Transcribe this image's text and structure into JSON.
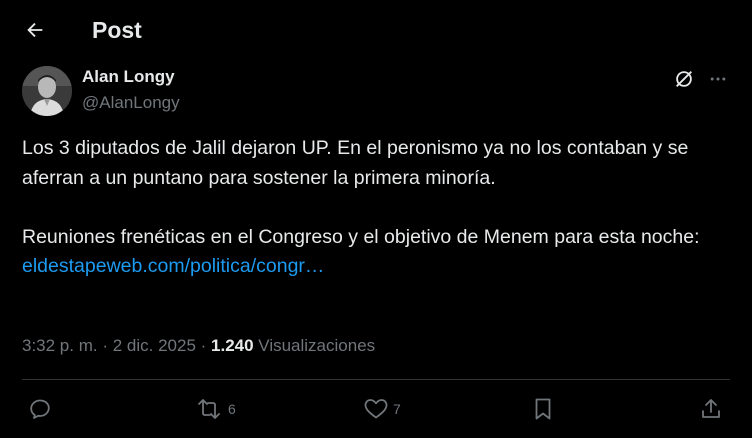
{
  "header": {
    "title": "Post"
  },
  "author": {
    "name": "Alan Longy",
    "handle": "@AlanLongy"
  },
  "tweet": {
    "paragraph1": "Los 3 diputados de Jalil dejaron UP. En el peronismo ya no los contaban y se aferran a un puntano para sostener la primera minoría.",
    "paragraph2": "Reuniones frenéticas en el Congreso y el objetivo de Menem para esta noche:",
    "link": "eldestapeweb.com/politica/congr…"
  },
  "meta": {
    "time": "3:32 p. m.",
    "separator1": " · ",
    "date": "2 dic. 2025",
    "separator2": " · ",
    "views_count": "1.240",
    "views_label": " Visualizaciones"
  },
  "actions": {
    "reposts": "6",
    "likes": "7"
  },
  "colors": {
    "background": "#000000",
    "text": "#e7e9ea",
    "secondary": "#71767b",
    "link": "#1d9bf0",
    "divider": "#2f3336"
  },
  "icons": {
    "back": "arrow-left-icon",
    "grok": "grok-icon",
    "more": "more-horizontal-icon",
    "reply": "reply-icon",
    "repost": "repost-icon",
    "like": "heart-icon",
    "bookmark": "bookmark-icon",
    "share": "share-icon"
  }
}
